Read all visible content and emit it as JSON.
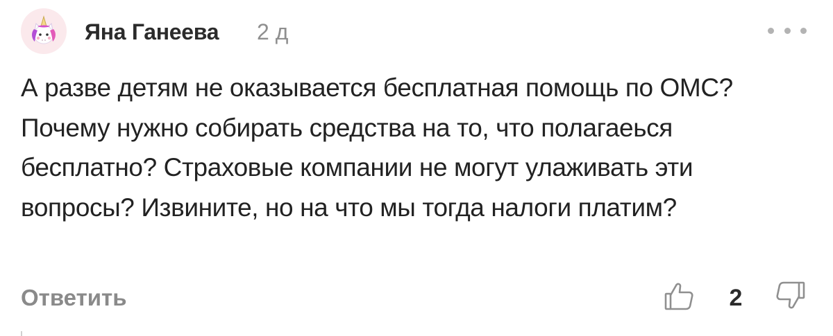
{
  "comment": {
    "author": "Яна Ганеева",
    "time": "2 д",
    "text": "А разве детям не оказывается бесплатная помощь по ОМС? Почему нужно собирать средства на то, что полагаеься бесплатно? Страховые компании не могут улаживать эти вопросы? Извините, но на что мы тогда налоги платим?",
    "reply_label": "Ответить",
    "likes": "2"
  },
  "icons": {
    "avatar": "unicorn-avatar",
    "more": "more-dots-icon",
    "like": "thumbs-up-icon",
    "dislike": "thumbs-down-icon"
  },
  "colors": {
    "author": "#2b2b2b",
    "muted": "#8a8a8a",
    "avatar_bg": "#fbe9ec",
    "text": "#222222"
  }
}
